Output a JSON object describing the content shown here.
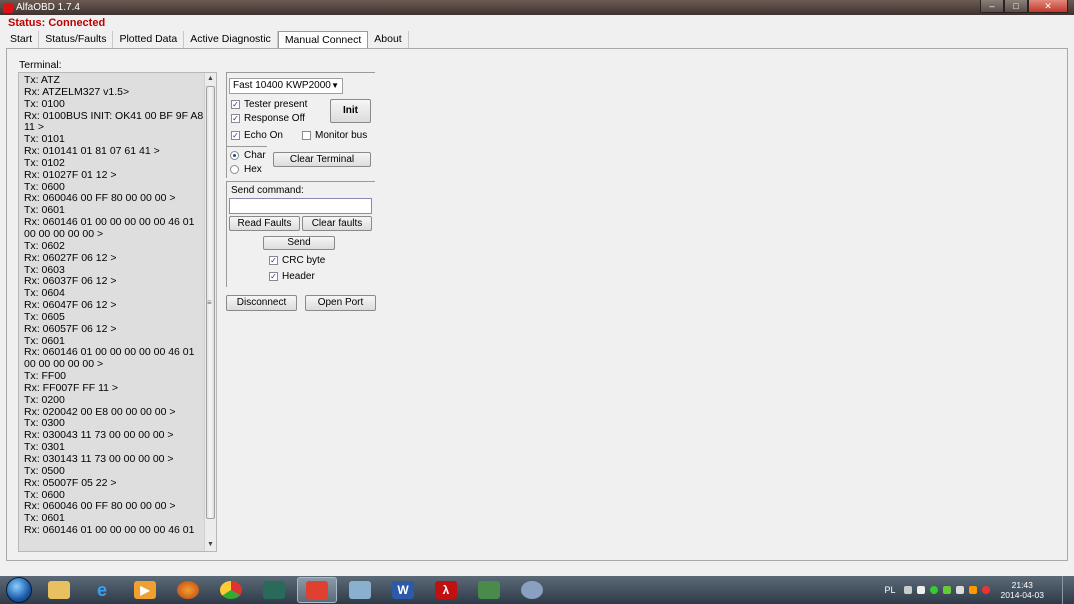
{
  "window": {
    "title": "AlfaOBD 1.7.4"
  },
  "status": "Status: Connected",
  "tabs": [
    {
      "label": "Start"
    },
    {
      "label": "Status/Faults"
    },
    {
      "label": "Plotted Data"
    },
    {
      "label": "Active Diagnostic"
    },
    {
      "label": "Manual Connect",
      "active": true
    },
    {
      "label": "About"
    }
  ],
  "terminal": {
    "label": "Terminal:",
    "lines": [
      "Tx: ATZ",
      "Rx: ATZELM327 v1.5>",
      "Tx: 0100",
      "Rx: 0100BUS INIT: OK41 00 BF 9F A8 11 >",
      "Tx: 0101",
      "Rx: 010141 01 81 07 61 41 >",
      "Tx: 0102",
      "Rx: 01027F 01 12 >",
      "Tx: 0600",
      "Rx: 060046 00 FF 80 00 00 00 >",
      "Tx: 0601",
      "Rx: 060146 01 00 00 00 00 00 46 01 00 00 00 00 00 >",
      "Tx: 0602",
      "Rx: 06027F 06 12 >",
      "Tx: 0603",
      "Rx: 06037F 06 12 >",
      "Tx: 0604",
      "Rx: 06047F 06 12 >",
      "Tx: 0605",
      "Rx: 06057F 06 12 >",
      "Tx: 0601",
      "Rx: 060146 01 00 00 00 00 00 46 01 00 00 00 00 00 >",
      "Tx: FF00",
      "Rx: FF007F FF 11 >",
      "Tx: 0200",
      "Rx: 020042 00 E8 00 00 00 00 >",
      "Tx: 0300",
      "Rx: 030043 11 73 00 00 00 00 >",
      "Tx: 0301",
      "Rx: 030143 11 73 00 00 00 00 >",
      "Tx: 0500",
      "Rx: 05007F 05 22 >",
      "Tx: 0600",
      "Rx: 060046 00 FF 80 00 00 00 >",
      "Tx: 0601",
      "Rx: 060146 01 00 00 00 00 00 46 01"
    ]
  },
  "connection": {
    "protocol_selected": "Fast 10400 KWP2000",
    "tester_present": {
      "label": "Tester present",
      "checked": true
    },
    "response_off": {
      "label": "Response Off",
      "checked": true
    },
    "init_label": "Init",
    "echo_on": {
      "label": "Echo On",
      "checked": true
    },
    "monitor_bus": {
      "label": "Monitor bus",
      "checked": false
    },
    "char_label": "Char",
    "hex_label": "Hex",
    "mode_selected": "Char",
    "clear_terminal_label": "Clear Terminal"
  },
  "command": {
    "label": "Send command:",
    "value": "",
    "read_faults_label": "Read Faults",
    "clear_faults_label": "Clear faults",
    "send_label": "Send",
    "crc_byte": {
      "label": "CRC byte",
      "checked": true
    },
    "header": {
      "label": "Header",
      "checked": true
    }
  },
  "footer_buttons": {
    "disconnect_label": "Disconnect",
    "open_port_label": "Open Port"
  },
  "taskbar": {
    "apps": [
      "explorer-icon",
      "internet-explorer-icon",
      "media-player-icon",
      "firefox-icon",
      "chrome-icon",
      "circuit-app-icon",
      "car-obd-icon",
      "notepad-icon",
      "word-icon",
      "acrobat-icon",
      "network-app-icon",
      "paint-icon"
    ],
    "language": "PL",
    "time": "21:43",
    "date": "2014-04-03"
  }
}
